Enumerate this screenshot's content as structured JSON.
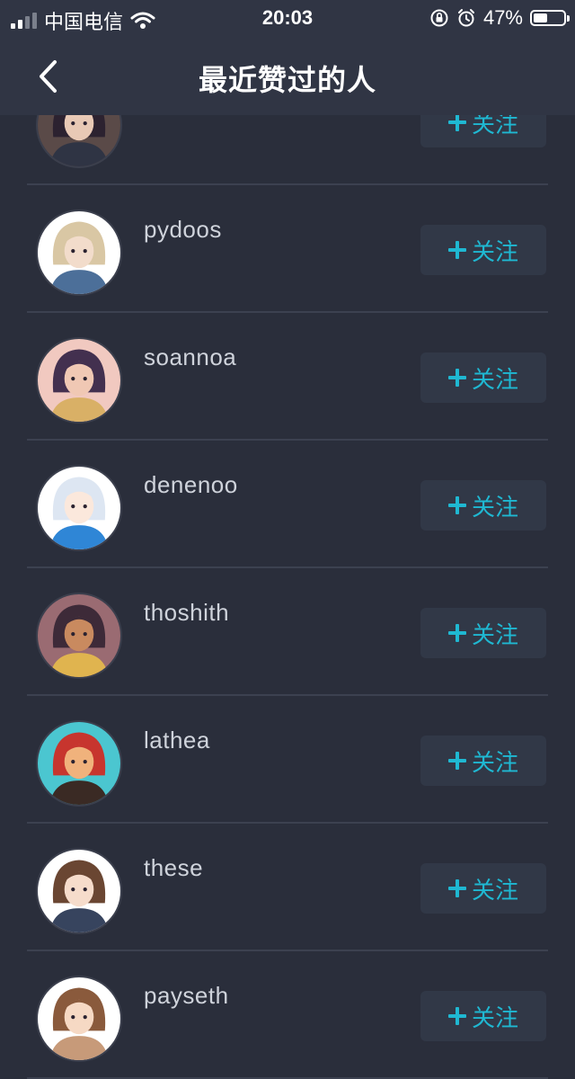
{
  "status_bar": {
    "carrier": "中国电信",
    "time": "20:03",
    "battery": "47%",
    "battery_level": 0.47,
    "icons": [
      "signal-icon",
      "wifi-icon",
      "orientation-lock-icon",
      "alarm-icon",
      "battery-icon"
    ]
  },
  "nav": {
    "title": "最近赞过的人",
    "back_icon": "chevron-left-icon"
  },
  "follow_label": "关注",
  "colors": {
    "accent": "#1fb8d2",
    "background": "#2a2e3b",
    "header": "#303544",
    "button": "#313847"
  },
  "users": [
    {
      "name": "",
      "avatar_bg": "#5a4a48",
      "avatar_hair": "#2c2230",
      "avatar_skin": "#e8c9b5",
      "avatar_cloth": "#2f3444"
    },
    {
      "name": "pydoos",
      "avatar_bg": "#ffffff",
      "avatar_hair": "#d9c7a4",
      "avatar_skin": "#f2dccb",
      "avatar_cloth": "#4c6f99"
    },
    {
      "name": "soannoa",
      "avatar_bg": "#f1c9c0",
      "avatar_hair": "#43304f",
      "avatar_skin": "#f0c8b4",
      "avatar_cloth": "#d9b066"
    },
    {
      "name": "denenoo",
      "avatar_bg": "#ffffff",
      "avatar_hair": "#dde6f2",
      "avatar_skin": "#fbe8dc",
      "avatar_cloth": "#2f86d6"
    },
    {
      "name": "thoshith",
      "avatar_bg": "#9a6b72",
      "avatar_hair": "#3d2a38",
      "avatar_skin": "#c98a5f",
      "avatar_cloth": "#e0b44f"
    },
    {
      "name": "lathea",
      "avatar_bg": "#4bc6d0",
      "avatar_hair": "#c7352e",
      "avatar_skin": "#f0b27c",
      "avatar_cloth": "#3a2a24"
    },
    {
      "name": "these",
      "avatar_bg": "#ffffff",
      "avatar_hair": "#6a4632",
      "avatar_skin": "#f6dccb",
      "avatar_cloth": "#37445e"
    },
    {
      "name": "payseth",
      "avatar_bg": "#ffffff",
      "avatar_hair": "#8a5a3c",
      "avatar_skin": "#f6d9c4",
      "avatar_cloth": "#c79a79"
    }
  ]
}
